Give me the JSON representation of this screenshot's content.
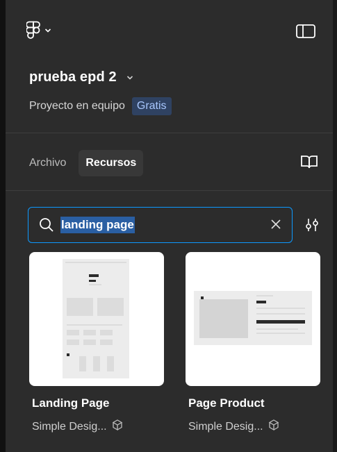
{
  "header": {
    "logo_icon": "figma-logo-icon",
    "logo_menu_icon": "chevron-down-icon",
    "sidebar_toggle_icon": "sidebar-panel-icon"
  },
  "project": {
    "title": "prueba epd 2",
    "subtitle": "Proyecto en equipo",
    "plan_badge": "Gratis"
  },
  "tabs": [
    {
      "label": "Archivo",
      "active": false
    },
    {
      "label": "Recursos",
      "active": true
    }
  ],
  "library_icon": "book-icon",
  "search": {
    "value": "landing page",
    "focused": true,
    "accent_color": "#0d99ff",
    "selection_color": "#2a5fa3"
  },
  "filter_icon": "adjust-filters-icon",
  "results": [
    {
      "title": "Landing Page",
      "author": "Simple Desig...",
      "type_icon": "component-icon"
    },
    {
      "title": "Page Product",
      "author": "Simple Desig...",
      "type_icon": "component-icon"
    }
  ],
  "colors": {
    "panel_bg": "#2c2c2c",
    "badge_bg": "#2f4262",
    "badge_text": "#a9c8ff"
  }
}
